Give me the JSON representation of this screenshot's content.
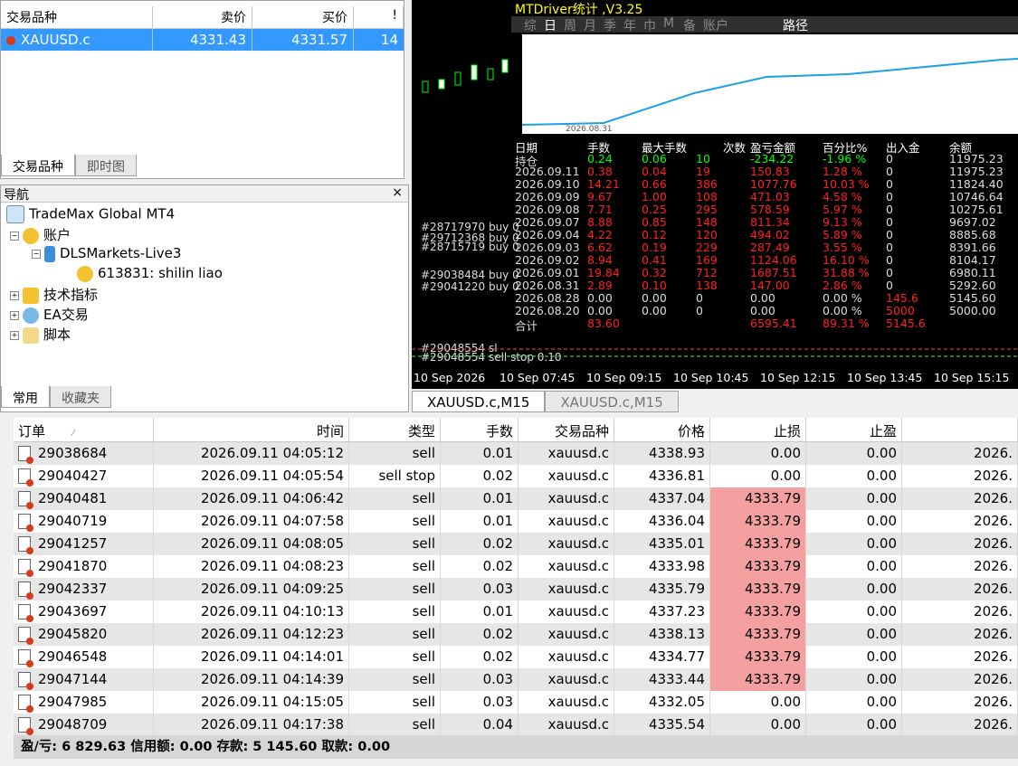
{
  "market_watch": {
    "columns": [
      "交易品种",
      "卖价",
      "买价",
      "!"
    ],
    "row": {
      "symbol": "XAUUSD.c",
      "bid": "4331.43",
      "ask": "4331.57",
      "spread": "14"
    },
    "tabs": [
      "交易品种",
      "即时图"
    ]
  },
  "navigator": {
    "title": "导航",
    "close": "×",
    "items": {
      "root": "TradeMax Global MT4",
      "accounts": "账户",
      "server": "DLSMarkets-Live3",
      "account": "613831: shilin liao",
      "indicators": "技术指标",
      "ea": "EA交易",
      "scripts": "脚本"
    },
    "tabs": [
      "常用",
      "收藏夹"
    ]
  },
  "chart": {
    "stats_title": "MTDriver统计 ,V3.25",
    "period_tabs": [
      "综",
      "日",
      "周",
      "月",
      "季",
      "年",
      "巾",
      "M",
      "备",
      "账户"
    ],
    "path_tab": "路径",
    "mini_date": "2026.08.31",
    "stats_headers": [
      "日期",
      "手数",
      "最大手数",
      "次数",
      "盈亏金额",
      "百分比%",
      "出入金",
      "余额"
    ],
    "stats_rows": [
      [
        "持仓",
        "0.24",
        "0.06",
        "10",
        "-234.22",
        "-1.96 %",
        "0",
        "11975.23"
      ],
      [
        "2026.09.11",
        "0.38",
        "0.04",
        "19",
        "150.83",
        "1.28 %",
        "0",
        "11975.23"
      ],
      [
        "2026.09.10",
        "14.21",
        "0.66",
        "386",
        "1077.76",
        "10.03 %",
        "0",
        "11824.40"
      ],
      [
        "2026.09.09",
        "9.67",
        "1.00",
        "108",
        "471.03",
        "4.58 %",
        "0",
        "10746.64"
      ],
      [
        "2026.09.08",
        "7.71",
        "0.25",
        "295",
        "578.59",
        "5.97 %",
        "0",
        "10275.61"
      ],
      [
        "2026.09.07",
        "8.88",
        "0.85",
        "148",
        "811.34",
        "9.13 %",
        "0",
        "9697.02"
      ],
      [
        "2026.09.04",
        "4.22",
        "0.12",
        "120",
        "494.02",
        "5.89 %",
        "0",
        "8885.68"
      ],
      [
        "2026.09.03",
        "6.62",
        "0.19",
        "229",
        "287.49",
        "3.55 %",
        "0",
        "8391.66"
      ],
      [
        "2026.09.02",
        "8.94",
        "0.41",
        "169",
        "1124.06",
        "16.10 %",
        "0",
        "8104.17"
      ],
      [
        "2026.09.01",
        "19.84",
        "0.32",
        "712",
        "1687.51",
        "31.88 %",
        "0",
        "6980.11"
      ],
      [
        "2026.08.31",
        "2.89",
        "0.10",
        "138",
        "147.00",
        "2.86 %",
        "0",
        "5292.60"
      ],
      [
        "2026.08.28",
        "0.00",
        "0.00",
        "0",
        "0.00",
        "0.00 %",
        "145.6",
        "5145.60"
      ],
      [
        "2026.08.20",
        "0.00",
        "0.00",
        "0",
        "0.00",
        "0.00 %",
        "5000",
        "5000.00"
      ],
      [
        "合计",
        "83.60",
        "",
        "",
        "6595.41",
        "89.31 %",
        "5145.6",
        ""
      ]
    ],
    "order_labels": [
      "#28717970 buy 0",
      "#29712368 buy 0",
      "#28715719 buy 0",
      "#29038484 buy 0",
      "#29041220 buy 0",
      "#29048554 sl",
      "#29048554 sell stop 0.10"
    ],
    "time_axis": [
      "10 Sep 2026",
      "10 Sep 07:45",
      "10 Sep 09:15",
      "10 Sep 10:45",
      "10 Sep 12:15",
      "10 Sep 13:45",
      "10 Sep 15:15"
    ],
    "tabs": [
      "XAUUSD.c,M15",
      "XAUUSD.c,M15"
    ]
  },
  "orders": {
    "headers": [
      "订单",
      "时间",
      "类型",
      "手数",
      "交易品种",
      "价格",
      "止损",
      "止盈",
      ""
    ],
    "sort_mark": "⁄",
    "rows": [
      [
        "29038684",
        "2026.09.11 04:05:12",
        "sell",
        "0.01",
        "xauusd.c",
        "4338.93",
        "0.00",
        "0.00",
        "2026."
      ],
      [
        "29040427",
        "2026.09.11 04:05:54",
        "sell stop",
        "0.02",
        "xauusd.c",
        "4336.81",
        "0.00",
        "0.00",
        "2026."
      ],
      [
        "29040481",
        "2026.09.11 04:06:42",
        "sell",
        "0.01",
        "xauusd.c",
        "4337.04",
        "4333.79",
        "0.00",
        "2026."
      ],
      [
        "29040719",
        "2026.09.11 04:07:58",
        "sell",
        "0.01",
        "xauusd.c",
        "4336.04",
        "4333.79",
        "0.00",
        "2026."
      ],
      [
        "29041257",
        "2026.09.11 04:08:05",
        "sell",
        "0.02",
        "xauusd.c",
        "4335.01",
        "4333.79",
        "0.00",
        "2026."
      ],
      [
        "29041870",
        "2026.09.11 04:08:23",
        "sell",
        "0.02",
        "xauusd.c",
        "4333.98",
        "4333.79",
        "0.00",
        "2026."
      ],
      [
        "29042337",
        "2026.09.11 04:09:25",
        "sell",
        "0.03",
        "xauusd.c",
        "4335.79",
        "4333.79",
        "0.00",
        "2026."
      ],
      [
        "29043697",
        "2026.09.11 04:10:13",
        "sell",
        "0.01",
        "xauusd.c",
        "4337.23",
        "4333.79",
        "0.00",
        "2026."
      ],
      [
        "29045820",
        "2026.09.11 04:12:23",
        "sell",
        "0.02",
        "xauusd.c",
        "4338.13",
        "4333.79",
        "0.00",
        "2026."
      ],
      [
        "29046548",
        "2026.09.11 04:14:01",
        "sell",
        "0.02",
        "xauusd.c",
        "4334.77",
        "4333.79",
        "0.00",
        "2026."
      ],
      [
        "29047144",
        "2026.09.11 04:14:39",
        "sell",
        "0.03",
        "xauusd.c",
        "4333.44",
        "4333.79",
        "0.00",
        "2026."
      ],
      [
        "29047985",
        "2026.09.11 04:15:05",
        "sell",
        "0.03",
        "xauusd.c",
        "4332.05",
        "0.00",
        "0.00",
        "2026."
      ],
      [
        "29048709",
        "2026.09.11 04:17:38",
        "sell",
        "0.04",
        "xauusd.c",
        "4335.54",
        "0.00",
        "0.00",
        "2026."
      ]
    ],
    "sl_highlight_rows": [
      2,
      3,
      4,
      5,
      6,
      7,
      8,
      9,
      10
    ],
    "balance": "盈/亏: 6 829.63  信用额: 0.00  存款: 5 145.60  取款: 0.00"
  },
  "colors": {
    "selection": "#3399ff",
    "sl_hit": "#f4a0a0",
    "stats_pos": "#00ff00",
    "stats_neg": "#ff2020",
    "stats_neutral": "#ffffff",
    "equity_line": "#1ea0e6"
  }
}
